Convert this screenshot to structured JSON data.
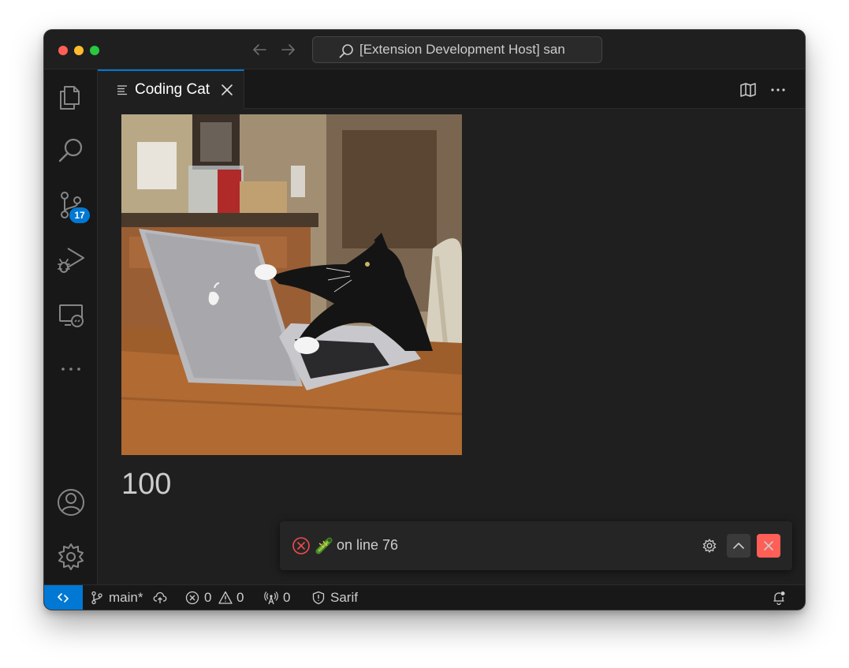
{
  "window": {
    "command_center": "[Extension Development Host] san"
  },
  "activity_bar": {
    "items": [
      "explorer-icon",
      "search-icon",
      "source-control-icon",
      "run-debug-icon",
      "remote-explorer-icon",
      "more-icon",
      "accounts-icon",
      "manage-gear-icon"
    ],
    "source_control_badge": "17"
  },
  "tabs": [
    {
      "label": "Coding Cat",
      "icon": "preview-icon",
      "active": true
    }
  ],
  "editor": {
    "image": "coding-cat-gif",
    "counter": "100"
  },
  "notification": {
    "severity": "error",
    "emoji": "🐛",
    "message": "on line 76"
  },
  "status_bar": {
    "branch": "main*",
    "errors": "0",
    "warnings": "0",
    "ports": "0",
    "sarif": "Sarif"
  },
  "colors": {
    "accent": "#0078d4",
    "error": "#f14c4c",
    "background": "#1f1f1f"
  }
}
